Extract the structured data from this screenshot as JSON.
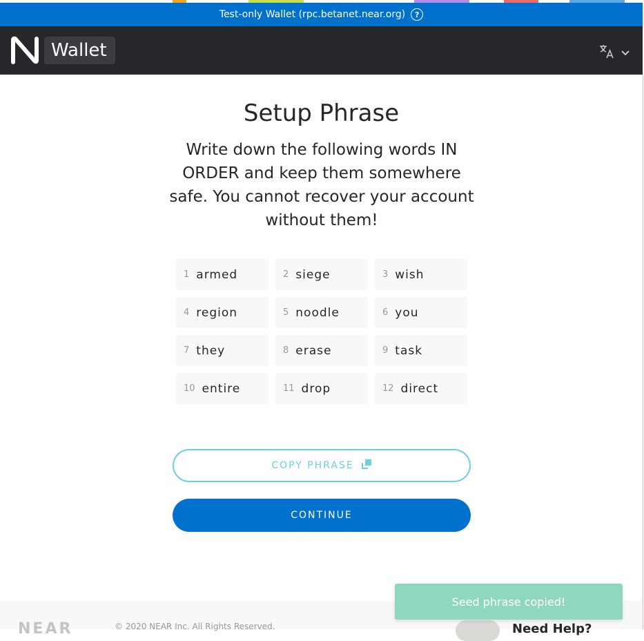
{
  "banner": {
    "text": "Test-only Wallet (rpc.betanet.near.org)",
    "icon": "help-icon"
  },
  "header": {
    "app_name": "Wallet",
    "logo_icon": "near-logo-icon",
    "language_icon": "translate-icon",
    "dropdown_icon": "chevron-down-icon"
  },
  "page": {
    "title": "Setup Phrase",
    "instructions": "Write down the following words IN ORDER and keep them somewhere safe. You cannot recover your account without them!"
  },
  "seed_words": [
    {
      "num": "1",
      "word": "armed"
    },
    {
      "num": "2",
      "word": "siege"
    },
    {
      "num": "3",
      "word": "wish"
    },
    {
      "num": "4",
      "word": "region"
    },
    {
      "num": "5",
      "word": "noodle"
    },
    {
      "num": "6",
      "word": "you"
    },
    {
      "num": "7",
      "word": "they"
    },
    {
      "num": "8",
      "word": "erase"
    },
    {
      "num": "9",
      "word": "task"
    },
    {
      "num": "10",
      "word": "entire"
    },
    {
      "num": "11",
      "word": "drop"
    },
    {
      "num": "12",
      "word": "direct"
    }
  ],
  "buttons": {
    "copy": "COPY PHRASE",
    "copy_icon": "copy-icon",
    "continue": "CONTINUE"
  },
  "footer": {
    "logo": "NEAR",
    "copyright": "© 2020 NEAR Inc. All Rights Reserved.",
    "help": "Need Help?"
  },
  "toast": {
    "message": "Seed phrase copied!"
  },
  "colors": {
    "brand_blue": "#0072ce",
    "navbar": "#25272a",
    "copy_accent": "#6ad1e3",
    "toast_bg": "#8fd7bd"
  }
}
